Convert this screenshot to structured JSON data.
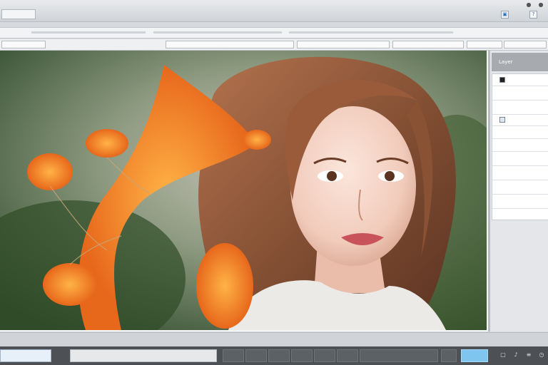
{
  "titlebar": {
    "tab_label": "",
    "buttons": [
      "minimize-icon",
      "close-icon"
    ],
    "icons": [
      "window-icon",
      "help-icon"
    ]
  },
  "menubar": {
    "items": [
      "",
      "",
      "",
      "",
      "",
      ""
    ]
  },
  "optionsbar": {
    "fields": [
      "",
      "",
      "",
      "",
      "",
      ""
    ]
  },
  "canvas": {
    "subject": "portrait",
    "accent": "#f08a2d"
  },
  "panel": {
    "title": "Layer",
    "rows": [
      "",
      "",
      "",
      "",
      "",
      "",
      "",
      "",
      "",
      ""
    ]
  },
  "taskbar": {
    "start_label": "",
    "search_placeholder": "",
    "apps": [
      "",
      "",
      "",
      "",
      "",
      "",
      "",
      ""
    ],
    "tray_button": "",
    "colors": {
      "accent": "#7ec6ef",
      "bar": "#4d5156"
    }
  }
}
